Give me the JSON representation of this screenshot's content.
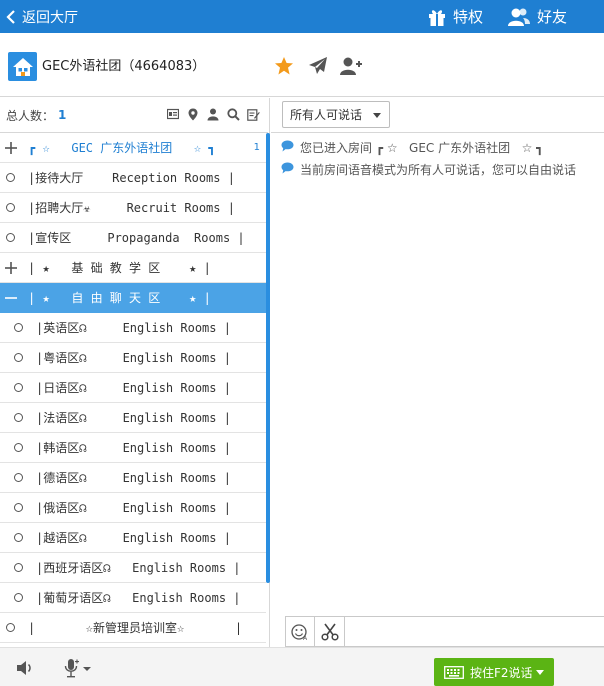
{
  "topbar": {
    "back_label": "返回大厅",
    "privilege_label": "特权",
    "friends_label": "好友"
  },
  "room": {
    "title": "GEC外语社团（4664083）",
    "icons": [
      "star-icon",
      "plane-icon",
      "add-user-icon"
    ]
  },
  "left_toolbar": {
    "count_label": "总人数：",
    "count_value": "1",
    "icons": [
      "card-icon",
      "location-icon",
      "person-icon",
      "search-icon",
      "edit-icon"
    ]
  },
  "rooms": [
    {
      "control": "plus",
      "text": "┏ ☆   GEC 广东外语社团   ☆ ┓",
      "count": "1",
      "level": 0,
      "selected": false
    },
    {
      "control": "circle",
      "text": "|接待大厅    Reception Rooms |",
      "level": 0,
      "selected": false
    },
    {
      "control": "circle",
      "text": "|招聘大厅☣     Recruit Rooms |",
      "level": 0,
      "selected": false
    },
    {
      "control": "circle",
      "text": "|宣传区     Propaganda  Rooms |",
      "level": 0,
      "selected": false
    },
    {
      "control": "plus",
      "text": "| ★   基 础 教 学 区    ★ |",
      "level": 0,
      "selected": false
    },
    {
      "control": "minus",
      "text": "| ★   自 由 聊 天 区    ★ |",
      "level": 0,
      "selected": true
    },
    {
      "control": "circle",
      "text": "|英语区☊     English Rooms |",
      "level": 1,
      "selected": false
    },
    {
      "control": "circle",
      "text": "|粤语区☊     English Rooms |",
      "level": 1,
      "selected": false
    },
    {
      "control": "circle",
      "text": "|日语区☊     English Rooms |",
      "level": 1,
      "selected": false
    },
    {
      "control": "circle",
      "text": "|法语区☊     English Rooms |",
      "level": 1,
      "selected": false
    },
    {
      "control": "circle",
      "text": "|韩语区☊     English Rooms |",
      "level": 1,
      "selected": false
    },
    {
      "control": "circle",
      "text": "|德语区☊     English Rooms |",
      "level": 1,
      "selected": false
    },
    {
      "control": "circle",
      "text": "|俄语区☊     English Rooms |",
      "level": 1,
      "selected": false
    },
    {
      "control": "circle",
      "text": "|越语区☊     English Rooms |",
      "level": 1,
      "selected": false
    },
    {
      "control": "circle",
      "text": "|西班牙语区☊   English Rooms |",
      "level": 1,
      "selected": false
    },
    {
      "control": "circle",
      "text": "|葡萄牙语区☊   English Rooms |",
      "level": 1,
      "selected": false
    },
    {
      "control": "circle",
      "text": "|       ☆新管理员培训室☆       |",
      "level": 0,
      "selected": false
    }
  ],
  "right_toolbar": {
    "speak_mode": "所有人可说话"
  },
  "messages": [
    {
      "text": "您已进入房间 ┏ ☆   GEC 广东外语社团   ☆ ┓"
    },
    {
      "text": "当前房间语音模式为所有人可说话，您可以自由说话"
    }
  ],
  "input": {
    "value": "",
    "placeholder": "",
    "icons": [
      "emoji-icon",
      "scissors-icon"
    ]
  },
  "bottombar": {
    "talk_label": "按住F2说话"
  },
  "colors": {
    "brand": "#1f7fd2",
    "selected_row": "#4ba3e6",
    "talk_button": "#5bb414",
    "star": "#f39a1b"
  }
}
